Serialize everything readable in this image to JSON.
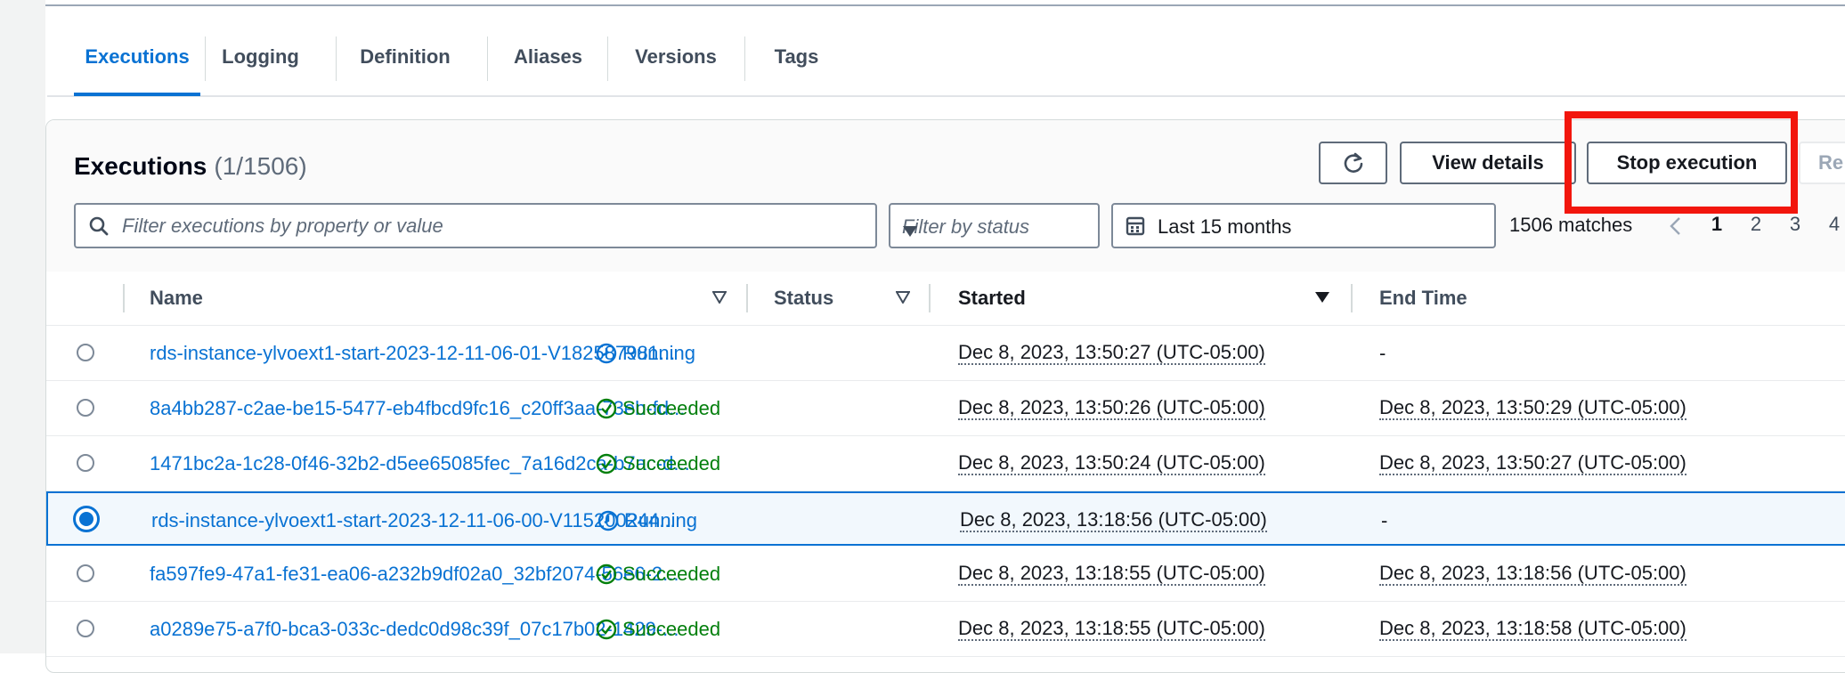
{
  "tabs": [
    {
      "label": "Executions",
      "active": true
    },
    {
      "label": "Logging"
    },
    {
      "label": "Definition"
    },
    {
      "label": "Aliases"
    },
    {
      "label": "Versions"
    },
    {
      "label": "Tags"
    }
  ],
  "panel": {
    "title": "Executions",
    "count": "(1/1506)",
    "refresh_icon": "refresh-icon",
    "buttons": {
      "view_details": "View details",
      "stop_execution": "Stop execution",
      "redrive_partial": "Re"
    },
    "search": {
      "placeholder": "Filter executions by property or value",
      "value": ""
    },
    "status_filter": {
      "placeholder": "Filter by status"
    },
    "date_filter": {
      "value": "Last 15 months"
    },
    "matches": "1506 matches",
    "pages": [
      "1",
      "2",
      "3",
      "4"
    ],
    "current_page": "1"
  },
  "table": {
    "columns": {
      "name": "Name",
      "status": "Status",
      "started": "Started",
      "end_time": "End Time"
    },
    "rows": [
      {
        "name": "rds-instance-ylvoext1-start-2023-12-11-06-01-V182587981...",
        "status": "Running",
        "started": "Dec 8, 2023, 13:50:27 (UTC-05:00)",
        "end": "-",
        "selected": false
      },
      {
        "name": "8a4bb287-c2ae-be15-5477-eb4fbcd9fc16_c20ff3aa-73eb-fd...",
        "status": "Succeeded",
        "started": "Dec 8, 2023, 13:50:26 (UTC-05:00)",
        "end": "Dec 8, 2023, 13:50:29 (UTC-05:00)",
        "selected": false
      },
      {
        "name": "1471bc2a-1c28-0f46-32b2-d5ee65085fec_7a16d2ca-b7ac-d...",
        "status": "Succeeded",
        "started": "Dec 8, 2023, 13:50:24 (UTC-05:00)",
        "end": "Dec 8, 2023, 13:50:27 (UTC-05:00)",
        "selected": false
      },
      {
        "name": "rds-instance-ylvoext1-start-2023-12-11-06-00-V115200244...",
        "status": "Running",
        "started": "Dec 8, 2023, 13:18:56 (UTC-05:00)",
        "end": "-",
        "selected": true
      },
      {
        "name": "fa597fe9-47a1-fe31-ea06-a232b9df02a0_32bf2074-56e6-2...",
        "status": "Succeeded",
        "started": "Dec 8, 2023, 13:18:55 (UTC-05:00)",
        "end": "Dec 8, 2023, 13:18:56 (UTC-05:00)",
        "selected": false
      },
      {
        "name": "a0289e75-a7f0-bca3-033c-dedc0d98c39f_07c17b02-1429-...",
        "status": "Succeeded",
        "started": "Dec 8, 2023, 13:18:55 (UTC-05:00)",
        "end": "Dec 8, 2023, 13:18:58 (UTC-05:00)",
        "selected": false
      }
    ]
  },
  "colors": {
    "accent": "#0972d3",
    "success": "#037f0c",
    "highlight": "#f2160d"
  }
}
